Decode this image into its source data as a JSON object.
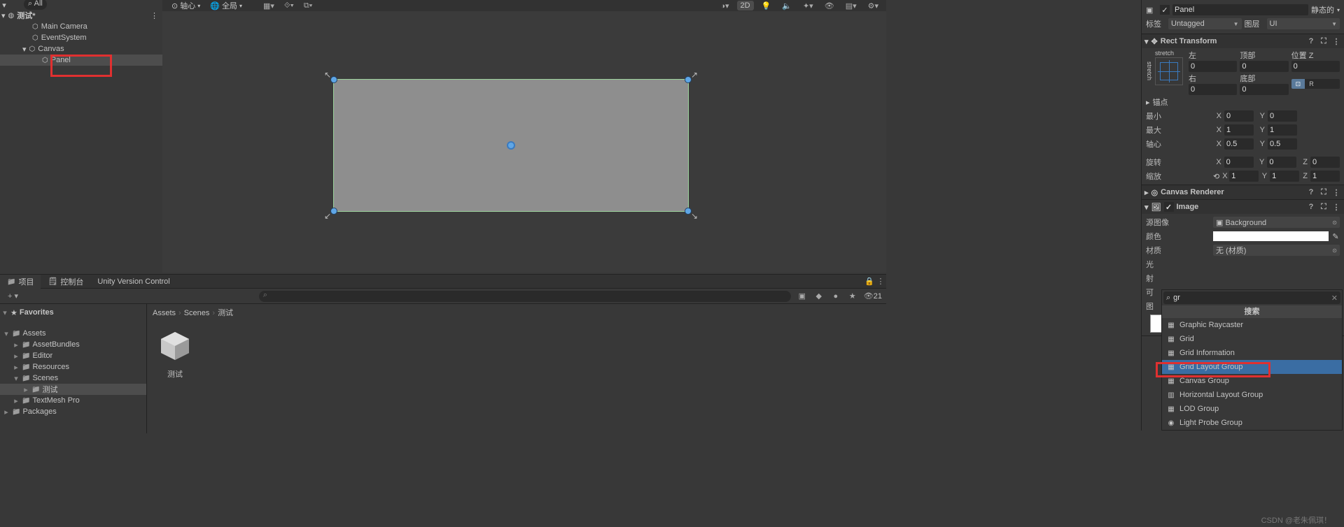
{
  "hierarchy": {
    "search_placeholder": "All",
    "scene_name": "测试*",
    "items": [
      {
        "name": "Main Camera",
        "indent": 1
      },
      {
        "name": "EventSystem",
        "indent": 1
      },
      {
        "name": "Canvas",
        "indent": 1,
        "expanded": true
      },
      {
        "name": "Panel",
        "indent": 2,
        "selected": true
      }
    ]
  },
  "scene_toolbar": {
    "pivot": "轴心",
    "space": "全局",
    "mode_2d": "2D"
  },
  "project": {
    "tab_project": "项目",
    "tab_console": "控制台",
    "tab_uvc": "Unity Version Control",
    "hidden_count": "21",
    "breadcrumb": [
      "Assets",
      "Scenes",
      "测试"
    ],
    "favorites": "Favorites",
    "tree": [
      {
        "name": "Assets",
        "indent": 0,
        "open": true
      },
      {
        "name": "AssetBundles",
        "indent": 1
      },
      {
        "name": "Editor",
        "indent": 1
      },
      {
        "name": "Resources",
        "indent": 1
      },
      {
        "name": "Scenes",
        "indent": 1,
        "open": true
      },
      {
        "name": "测试",
        "indent": 2,
        "selected": true
      },
      {
        "name": "TextMesh Pro",
        "indent": 1
      },
      {
        "name": "Packages",
        "indent": 0
      }
    ],
    "asset_name": "测试"
  },
  "inspector": {
    "object_name": "Panel",
    "static_label": "静态的",
    "tag_label": "标签",
    "tag_value": "Untagged",
    "layer_label": "图层",
    "layer_value": "UI",
    "rect": {
      "title": "Rect Transform",
      "stretch_h": "stretch",
      "stretch_v": "stretch",
      "left_label": "左",
      "top_label": "顶部",
      "posz_label": "位置 Z",
      "right_label": "右",
      "bottom_label": "底部",
      "left": "0",
      "top": "0",
      "posz": "0",
      "right": "0",
      "bottom": "0",
      "anchors": "锚点",
      "min": "最小",
      "max": "最大",
      "pivot": "轴心",
      "rotation": "旋转",
      "scale": "缩放",
      "min_x": "0",
      "min_y": "0",
      "max_x": "1",
      "max_y": "1",
      "piv_x": "0.5",
      "piv_y": "0.5",
      "rot_x": "0",
      "rot_y": "0",
      "rot_z": "0",
      "scl_x": "1",
      "scl_y": "1",
      "scl_z": "1",
      "bp_on": "",
      "bp_off": "R"
    },
    "canvas_renderer": "Canvas Renderer",
    "image": {
      "title": "Image",
      "source_label": "源图像",
      "source_value": "Background",
      "color_label": "颜色",
      "material_label": "材质",
      "material_value": "无 (材质)",
      "ray_label": "射",
      "light_label": "光",
      "ke_label": "可",
      "tu_label": "图"
    },
    "add_component": {
      "query": "gr",
      "search_header": "搜索",
      "items": [
        {
          "name": "Graphic Raycaster",
          "icon": "▦"
        },
        {
          "name": "Grid",
          "icon": "▦"
        },
        {
          "name": "Grid Information",
          "icon": "▦"
        },
        {
          "name": "Grid Layout Group",
          "icon": "▦",
          "selected": true
        },
        {
          "name": "Canvas Group",
          "icon": "▦"
        },
        {
          "name": "Horizontal Layout Group",
          "icon": "▥"
        },
        {
          "name": "LOD Group",
          "icon": "▦"
        },
        {
          "name": "Light Probe Group",
          "icon": "◉"
        }
      ]
    }
  },
  "watermark": "CSDN @老朱佩琪！"
}
